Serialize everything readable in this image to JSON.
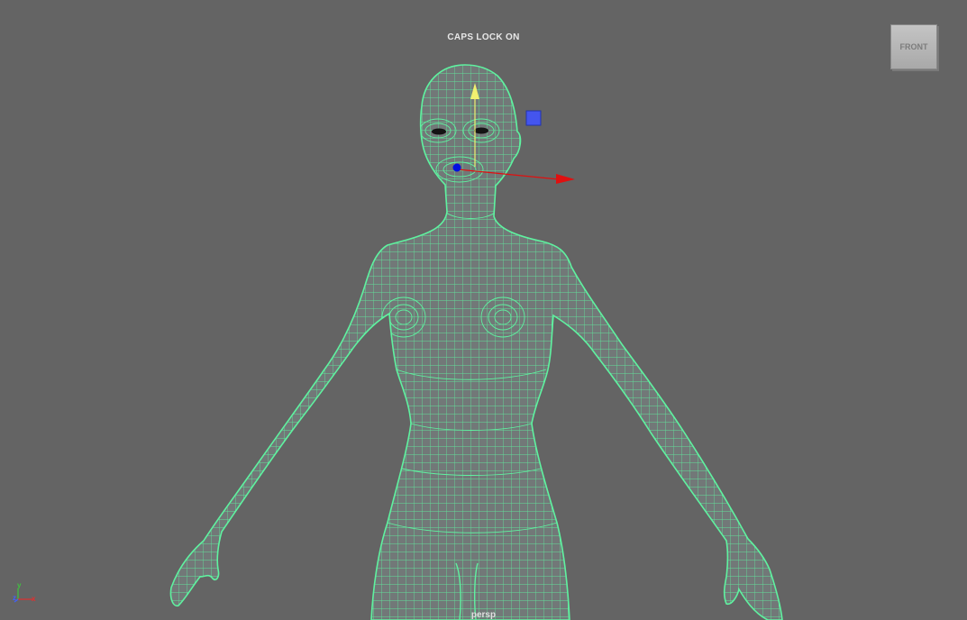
{
  "viewport": {
    "hud_message": "CAPS LOCK ON",
    "camera_name": "persp",
    "background_color": "#646464",
    "wireframe_color": "#5ff2a0"
  },
  "view_cube": {
    "face_label": "FRONT"
  },
  "axis_indicator": {
    "y_label": "y",
    "z_label": "z",
    "x_label": "x"
  },
  "manipulator": {
    "type": "move-tool",
    "x_color": "#e01010",
    "y_color": "#f0f070",
    "z_color": "#0010e0",
    "plane_handle_color": "#4455ee"
  }
}
